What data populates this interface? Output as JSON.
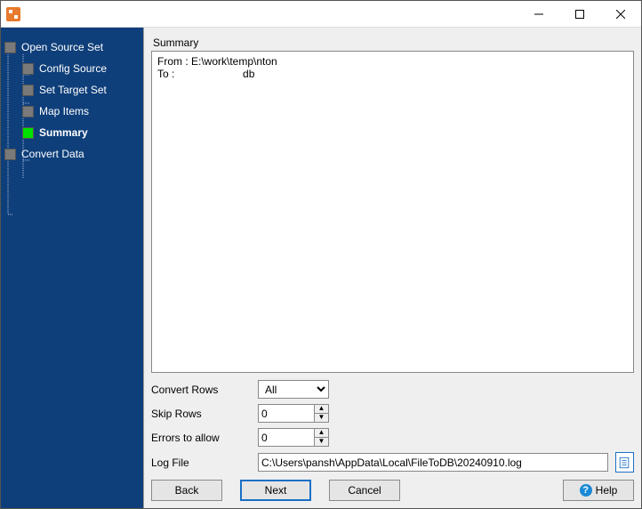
{
  "window": {
    "title": ""
  },
  "sidebar": {
    "items": [
      {
        "label": "Open Source Set",
        "active": false,
        "child": false
      },
      {
        "label": "Config Source",
        "active": false,
        "child": true
      },
      {
        "label": "Set Target Set",
        "active": false,
        "child": true
      },
      {
        "label": "Map Items",
        "active": false,
        "child": true
      },
      {
        "label": "Summary",
        "active": true,
        "child": true
      },
      {
        "label": "Convert Data",
        "active": false,
        "child": false
      }
    ]
  },
  "main": {
    "summary_label": "Summary",
    "summary_text": "From : E:\\work\\temp\\nton\nTo :                       db",
    "form": {
      "convert_rows_label": "Convert Rows",
      "convert_rows_value": "All",
      "convert_rows_options": [
        "All"
      ],
      "skip_rows_label": "Skip Rows",
      "skip_rows_value": "0",
      "errors_label": "Errors to allow",
      "errors_value": "0",
      "logfile_label": "Log File",
      "logfile_value": "C:\\Users\\pansh\\AppData\\Local\\FileToDB\\20240910.log"
    },
    "buttons": {
      "back": "Back",
      "next": "Next",
      "cancel": "Cancel",
      "help": "Help"
    }
  }
}
